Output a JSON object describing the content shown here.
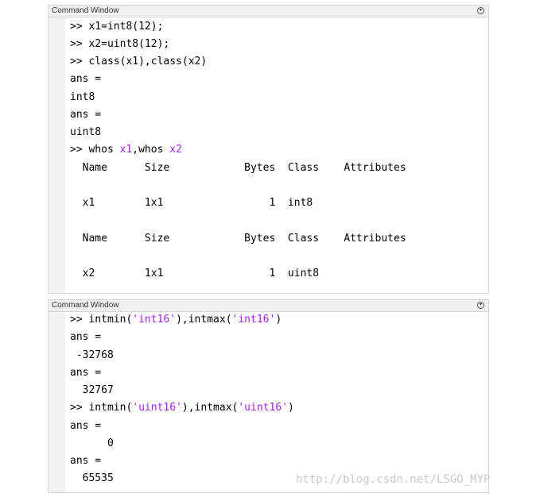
{
  "panel1": {
    "title": "Command Window",
    "lines": [
      {
        "parts": [
          {
            "t": ">> x1=int8(12);"
          }
        ]
      },
      {
        "parts": [
          {
            "t": ">> x2=uint8(12);"
          }
        ]
      },
      {
        "parts": [
          {
            "t": ">> class(x1),class(x2)"
          }
        ]
      },
      {
        "parts": [
          {
            "t": "ans ="
          }
        ]
      },
      {
        "parts": [
          {
            "t": "int8"
          }
        ]
      },
      {
        "parts": [
          {
            "t": "ans ="
          }
        ]
      },
      {
        "parts": [
          {
            "t": "uint8"
          }
        ]
      },
      {
        "parts": [
          {
            "t": ">> whos "
          },
          {
            "t": "x1",
            "s": true
          },
          {
            "t": ",whos "
          },
          {
            "t": "x2",
            "s": true
          }
        ]
      },
      {
        "parts": [
          {
            "t": "  Name      Size            Bytes  Class    Attributes"
          }
        ]
      },
      {
        "parts": [
          {
            "t": ""
          }
        ]
      },
      {
        "parts": [
          {
            "t": "  x1        1x1                 1  int8"
          }
        ]
      },
      {
        "parts": [
          {
            "t": ""
          }
        ]
      },
      {
        "parts": [
          {
            "t": "  Name      Size            Bytes  Class    Attributes"
          }
        ]
      },
      {
        "parts": [
          {
            "t": ""
          }
        ]
      },
      {
        "parts": [
          {
            "t": "  x2        1x1                 1  uint8"
          }
        ]
      }
    ]
  },
  "panel2": {
    "title": "Command Window",
    "lines": [
      {
        "parts": [
          {
            "t": ">> intmin("
          },
          {
            "t": "'int16'",
            "s": true
          },
          {
            "t": "),intmax("
          },
          {
            "t": "'int16'",
            "s": true
          },
          {
            "t": ")"
          }
        ]
      },
      {
        "parts": [
          {
            "t": "ans ="
          }
        ]
      },
      {
        "parts": [
          {
            "t": " -32768"
          }
        ]
      },
      {
        "parts": [
          {
            "t": "ans ="
          }
        ]
      },
      {
        "parts": [
          {
            "t": "  32767"
          }
        ]
      },
      {
        "parts": [
          {
            "t": ">> intmin("
          },
          {
            "t": "'uint16'",
            "s": true
          },
          {
            "t": "),intmax("
          },
          {
            "t": "'uint16'",
            "s": true
          },
          {
            "t": ")"
          }
        ]
      },
      {
        "parts": [
          {
            "t": "ans ="
          }
        ]
      },
      {
        "parts": [
          {
            "t": "      0"
          }
        ]
      },
      {
        "parts": [
          {
            "t": "ans ="
          }
        ]
      },
      {
        "parts": [
          {
            "t": "  65535"
          }
        ]
      }
    ]
  },
  "watermark": "http://blog.csdn.net/LSGO_MYP",
  "colors": {
    "string": "#a020f0",
    "text": "#000000",
    "gutter": "#f2f2f2"
  }
}
